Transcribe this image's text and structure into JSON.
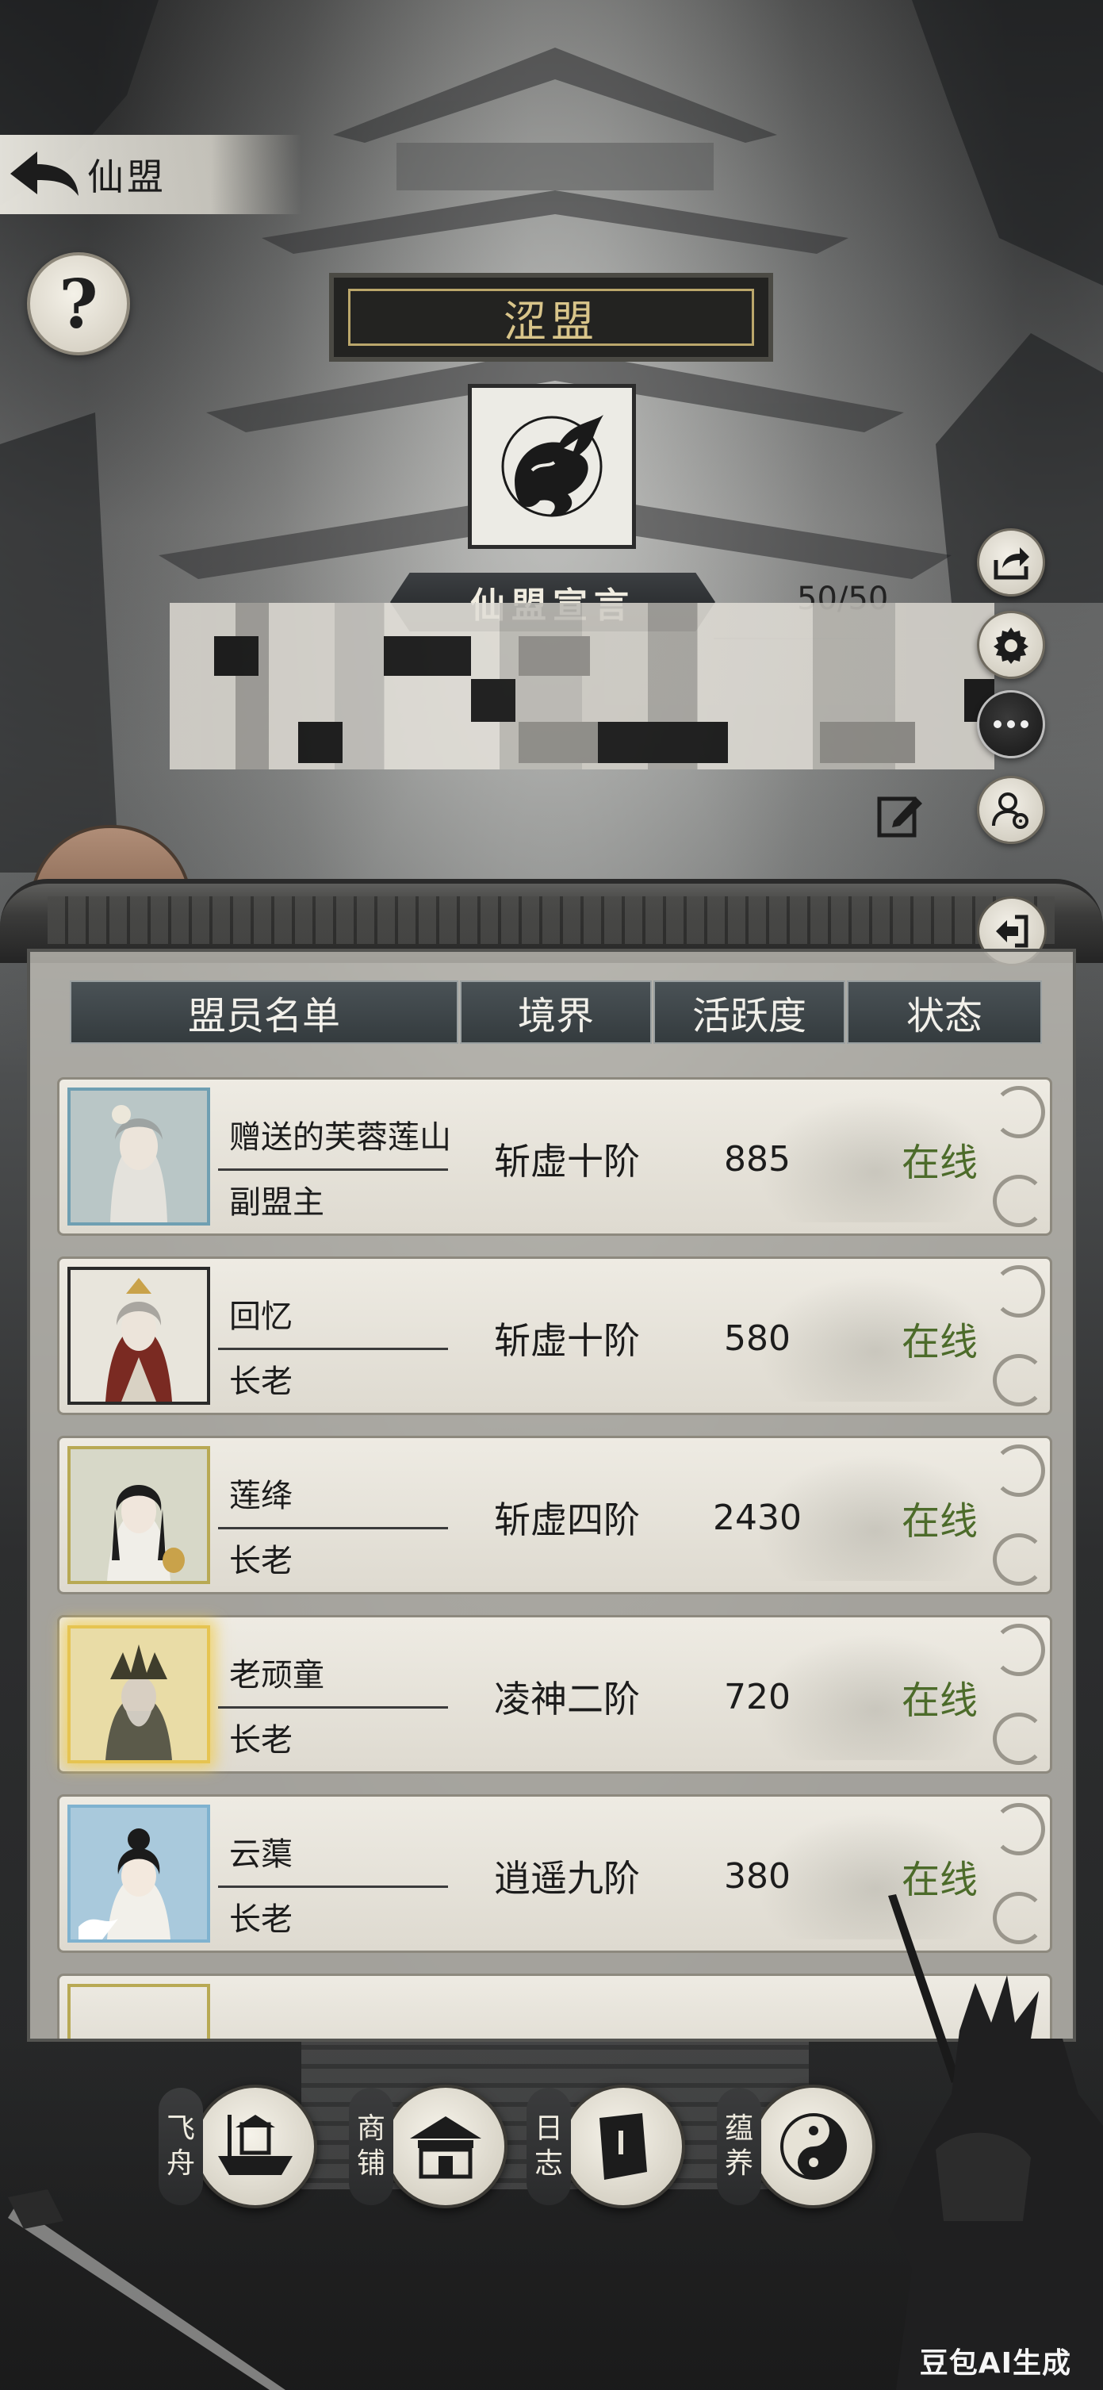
{
  "topbar": {
    "title": "仙盟"
  },
  "alliance": {
    "name": "涩盟"
  },
  "declaration": {
    "title": "仙盟宣言",
    "count": "50/50"
  },
  "table": {
    "headers": [
      "盟员名单",
      "境界",
      "活跃度",
      "状态"
    ],
    "rows": [
      {
        "name": "赠送的芙蓉莲山",
        "role": "副盟主",
        "realm": "斩虚十阶",
        "activity": "885",
        "status": "在线",
        "frame": "blue"
      },
      {
        "name": "回忆",
        "role": "长老",
        "realm": "斩虚十阶",
        "activity": "580",
        "status": "在线",
        "frame": "plain"
      },
      {
        "name": "莲绛",
        "role": "长老",
        "realm": "斩虚四阶",
        "activity": "2430",
        "status": "在线",
        "frame": "green"
      },
      {
        "name": "老顽童",
        "role": "长老",
        "realm": "凌神二阶",
        "activity": "720",
        "status": "在线",
        "frame": "gold"
      },
      {
        "name": "云蕖",
        "role": "长老",
        "realm": "逍遥九阶",
        "activity": "380",
        "status": "在线",
        "frame": "sky"
      }
    ]
  },
  "nav": [
    {
      "label": "飞舟",
      "icon": "boat-icon"
    },
    {
      "label": "商铺",
      "icon": "shop-icon"
    },
    {
      "label": "日志",
      "icon": "book-icon"
    },
    {
      "label": "蕴养",
      "icon": "taiji-icon"
    }
  ],
  "watermark": "豆包AI生成",
  "colors": {
    "status_online": "#4c6b2a",
    "title_gold": "#d9c58a"
  }
}
